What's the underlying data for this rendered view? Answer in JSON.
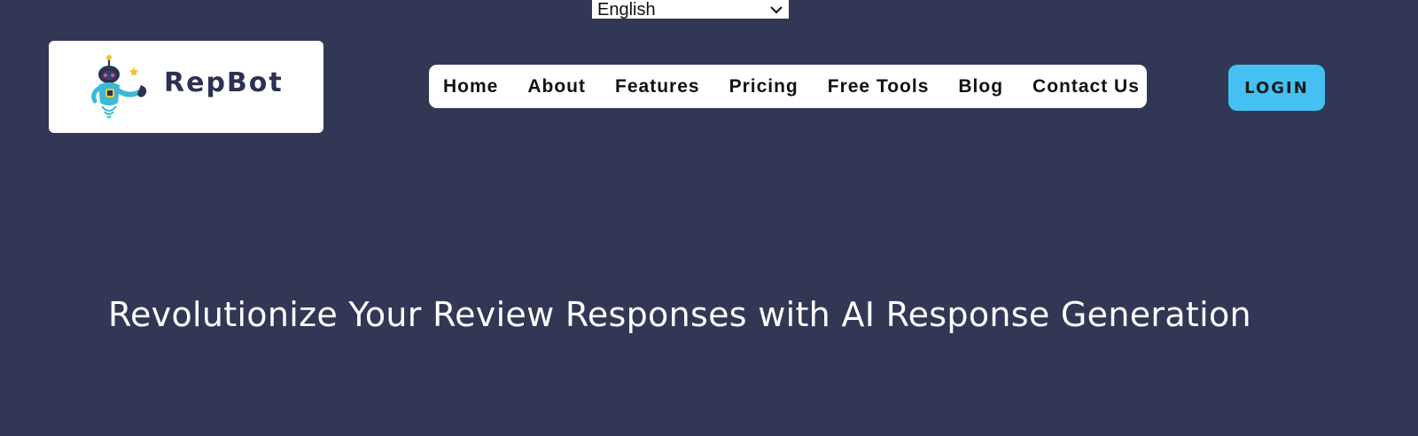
{
  "language_selector": {
    "selected": "English",
    "icon": "chevron-down-icon"
  },
  "logo": {
    "text": "RepBot",
    "icon": "robot-mascot-icon"
  },
  "nav": {
    "items": [
      {
        "label": "Home"
      },
      {
        "label": "About"
      },
      {
        "label": "Features"
      },
      {
        "label": "Pricing"
      },
      {
        "label": "Free Tools"
      },
      {
        "label": "Blog"
      },
      {
        "label": "Contact Us"
      }
    ]
  },
  "login": {
    "label": "LOGIN"
  },
  "hero": {
    "title": "Revolutionize Your Review Responses with AI Response Generation"
  },
  "colors": {
    "background": "#323756",
    "accent": "#44c1f2",
    "logo_text": "#2b3252"
  }
}
